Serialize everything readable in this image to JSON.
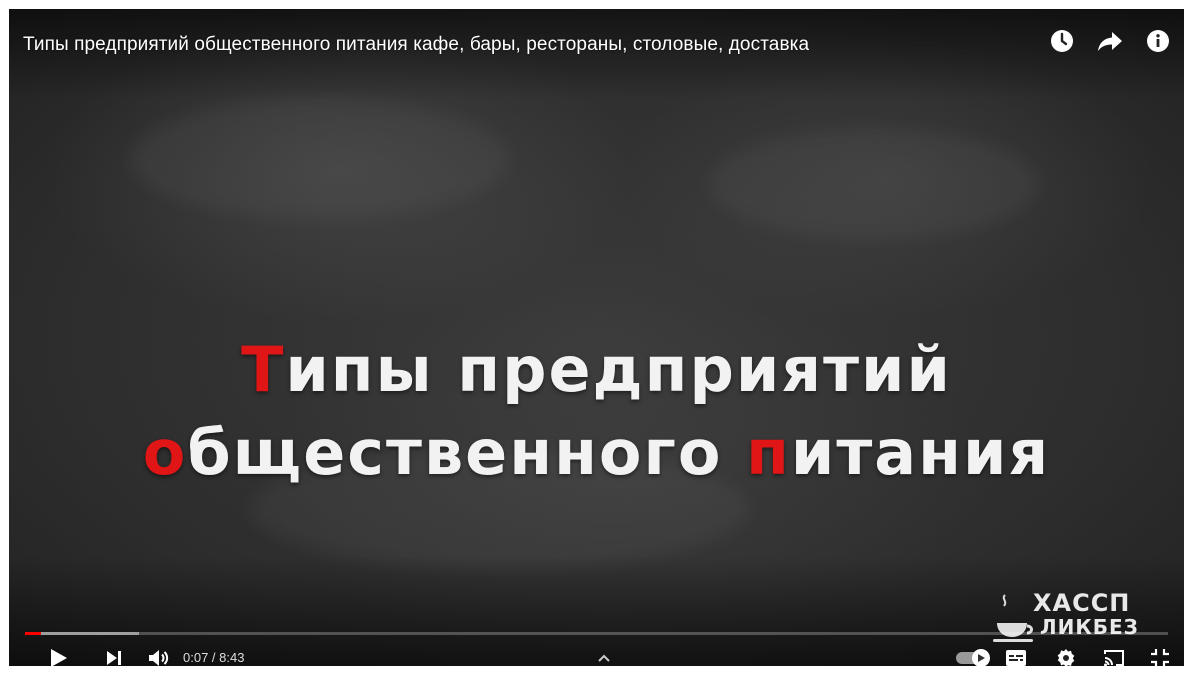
{
  "player": {
    "title": "Типы предприятий общественного питания кафе, бары, рестораны, столовые, доставка",
    "top_icons": [
      "watch-later-icon",
      "share-icon",
      "info-icon"
    ]
  },
  "slide": {
    "line1": {
      "first_letter": "Т",
      "rest": "ипы предприятий"
    },
    "line2": [
      {
        "text": "о",
        "accent": true
      },
      {
        "text": "бщественного ",
        "accent": false
      },
      {
        "text": "п",
        "accent": true
      },
      {
        "text": "итания",
        "accent": false
      }
    ],
    "accent_color": "#e01515"
  },
  "logo": {
    "line1": "ХАССП",
    "line2": "ЛИКБЕЗ"
  },
  "controls": {
    "current_time": "0:07",
    "separator": " / ",
    "duration": "8:43",
    "played_fraction": 0.014,
    "buffered_fraction": 0.1,
    "autoplay": true,
    "icons": [
      "play-icon",
      "next-icon",
      "volume-icon",
      "chevron-up-icon",
      "autoplay-toggle",
      "subtitles-icon",
      "settings-icon",
      "cast-icon",
      "exit-fullscreen-icon"
    ]
  },
  "colors": {
    "progress": "#ff0000",
    "text": "#ffffff"
  }
}
